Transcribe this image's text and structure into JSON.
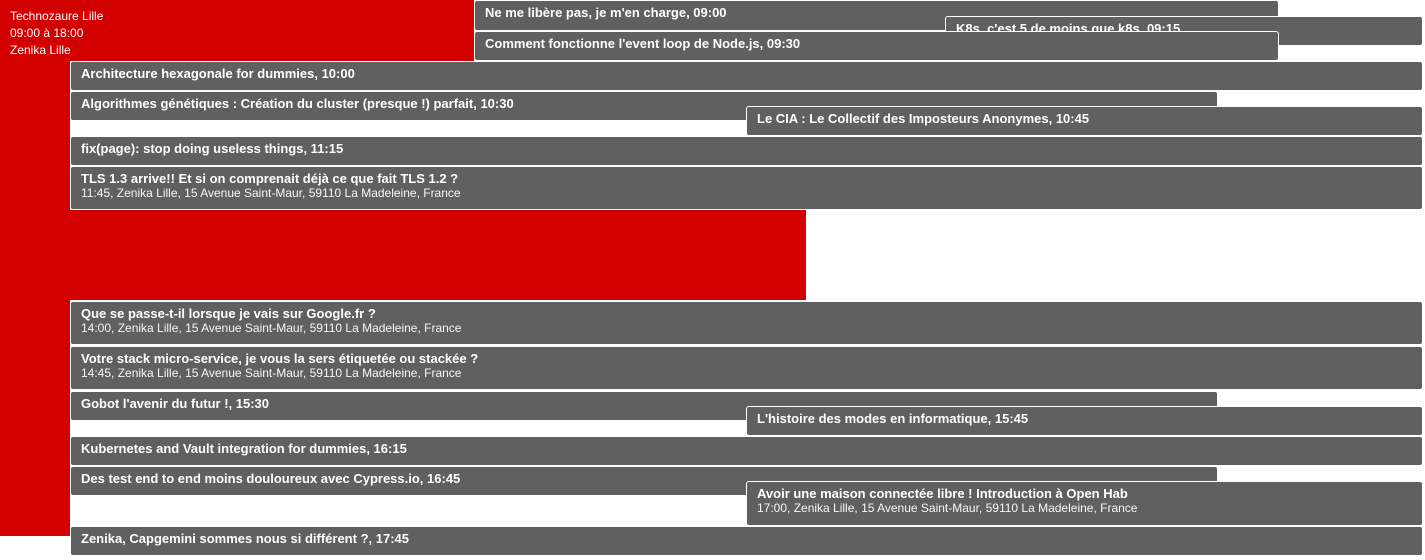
{
  "conference": {
    "name": "Technozaure Lille",
    "hours": "09:00 à 18:00",
    "place": "Zenika Lille"
  },
  "colors": {
    "conference": "#d20000",
    "session": "#606060",
    "text": "#ffffff"
  },
  "sessions": [
    {
      "title": "Ne me libère pas, je m'en charge, 09:00",
      "subtitle": ""
    },
    {
      "title": "K8s, c'est 5 de moins que k8s, 09:15",
      "subtitle": ""
    },
    {
      "title": "Comment fonctionne l'event loop de Node.js, 09:30",
      "subtitle": ""
    },
    {
      "title": "Architecture hexagonale for dummies, 10:00",
      "subtitle": ""
    },
    {
      "title": "Algorithmes génétiques : Création du cluster (presque !) parfait, 10:30",
      "subtitle": ""
    },
    {
      "title": "Le CIA : Le Collectif des Imposteurs Anonymes, 10:45",
      "subtitle": ""
    },
    {
      "title": "fix(page): stop doing useless things, 11:15",
      "subtitle": ""
    },
    {
      "title": "TLS 1.3 arrive!! Et si on comprenait déjà ce que fait TLS 1.2 ?",
      "subtitle": "11:45, Zenika Lille, 15 Avenue Saint-Maur, 59110 La Madeleine, France"
    },
    {
      "title": "Que se passe-t-il lorsque je vais sur Google.fr ?",
      "subtitle": "14:00, Zenika Lille, 15 Avenue Saint-Maur, 59110 La Madeleine, France"
    },
    {
      "title": "Votre stack micro-service, je vous la sers étiquetée ou stackée ?",
      "subtitle": "14:45, Zenika Lille, 15 Avenue Saint-Maur, 59110 La Madeleine, France"
    },
    {
      "title": "Gobot l'avenir du futur !, 15:30",
      "subtitle": ""
    },
    {
      "title": "L'histoire des modes en informatique, 15:45",
      "subtitle": ""
    },
    {
      "title": "Kubernetes and Vault integration for dummies, 16:15",
      "subtitle": ""
    },
    {
      "title": "Des test end to end moins douloureux avec Cypress.io, 16:45",
      "subtitle": ""
    },
    {
      "title": "Avoir une maison connectée libre ! Introduction à Open Hab",
      "subtitle": "17:00, Zenika Lille, 15 Avenue Saint-Maur, 59110 La Madeleine, France"
    },
    {
      "title": "Zenika, Capgemini sommes nous si différent ?, 17:45",
      "subtitle": ""
    }
  ]
}
